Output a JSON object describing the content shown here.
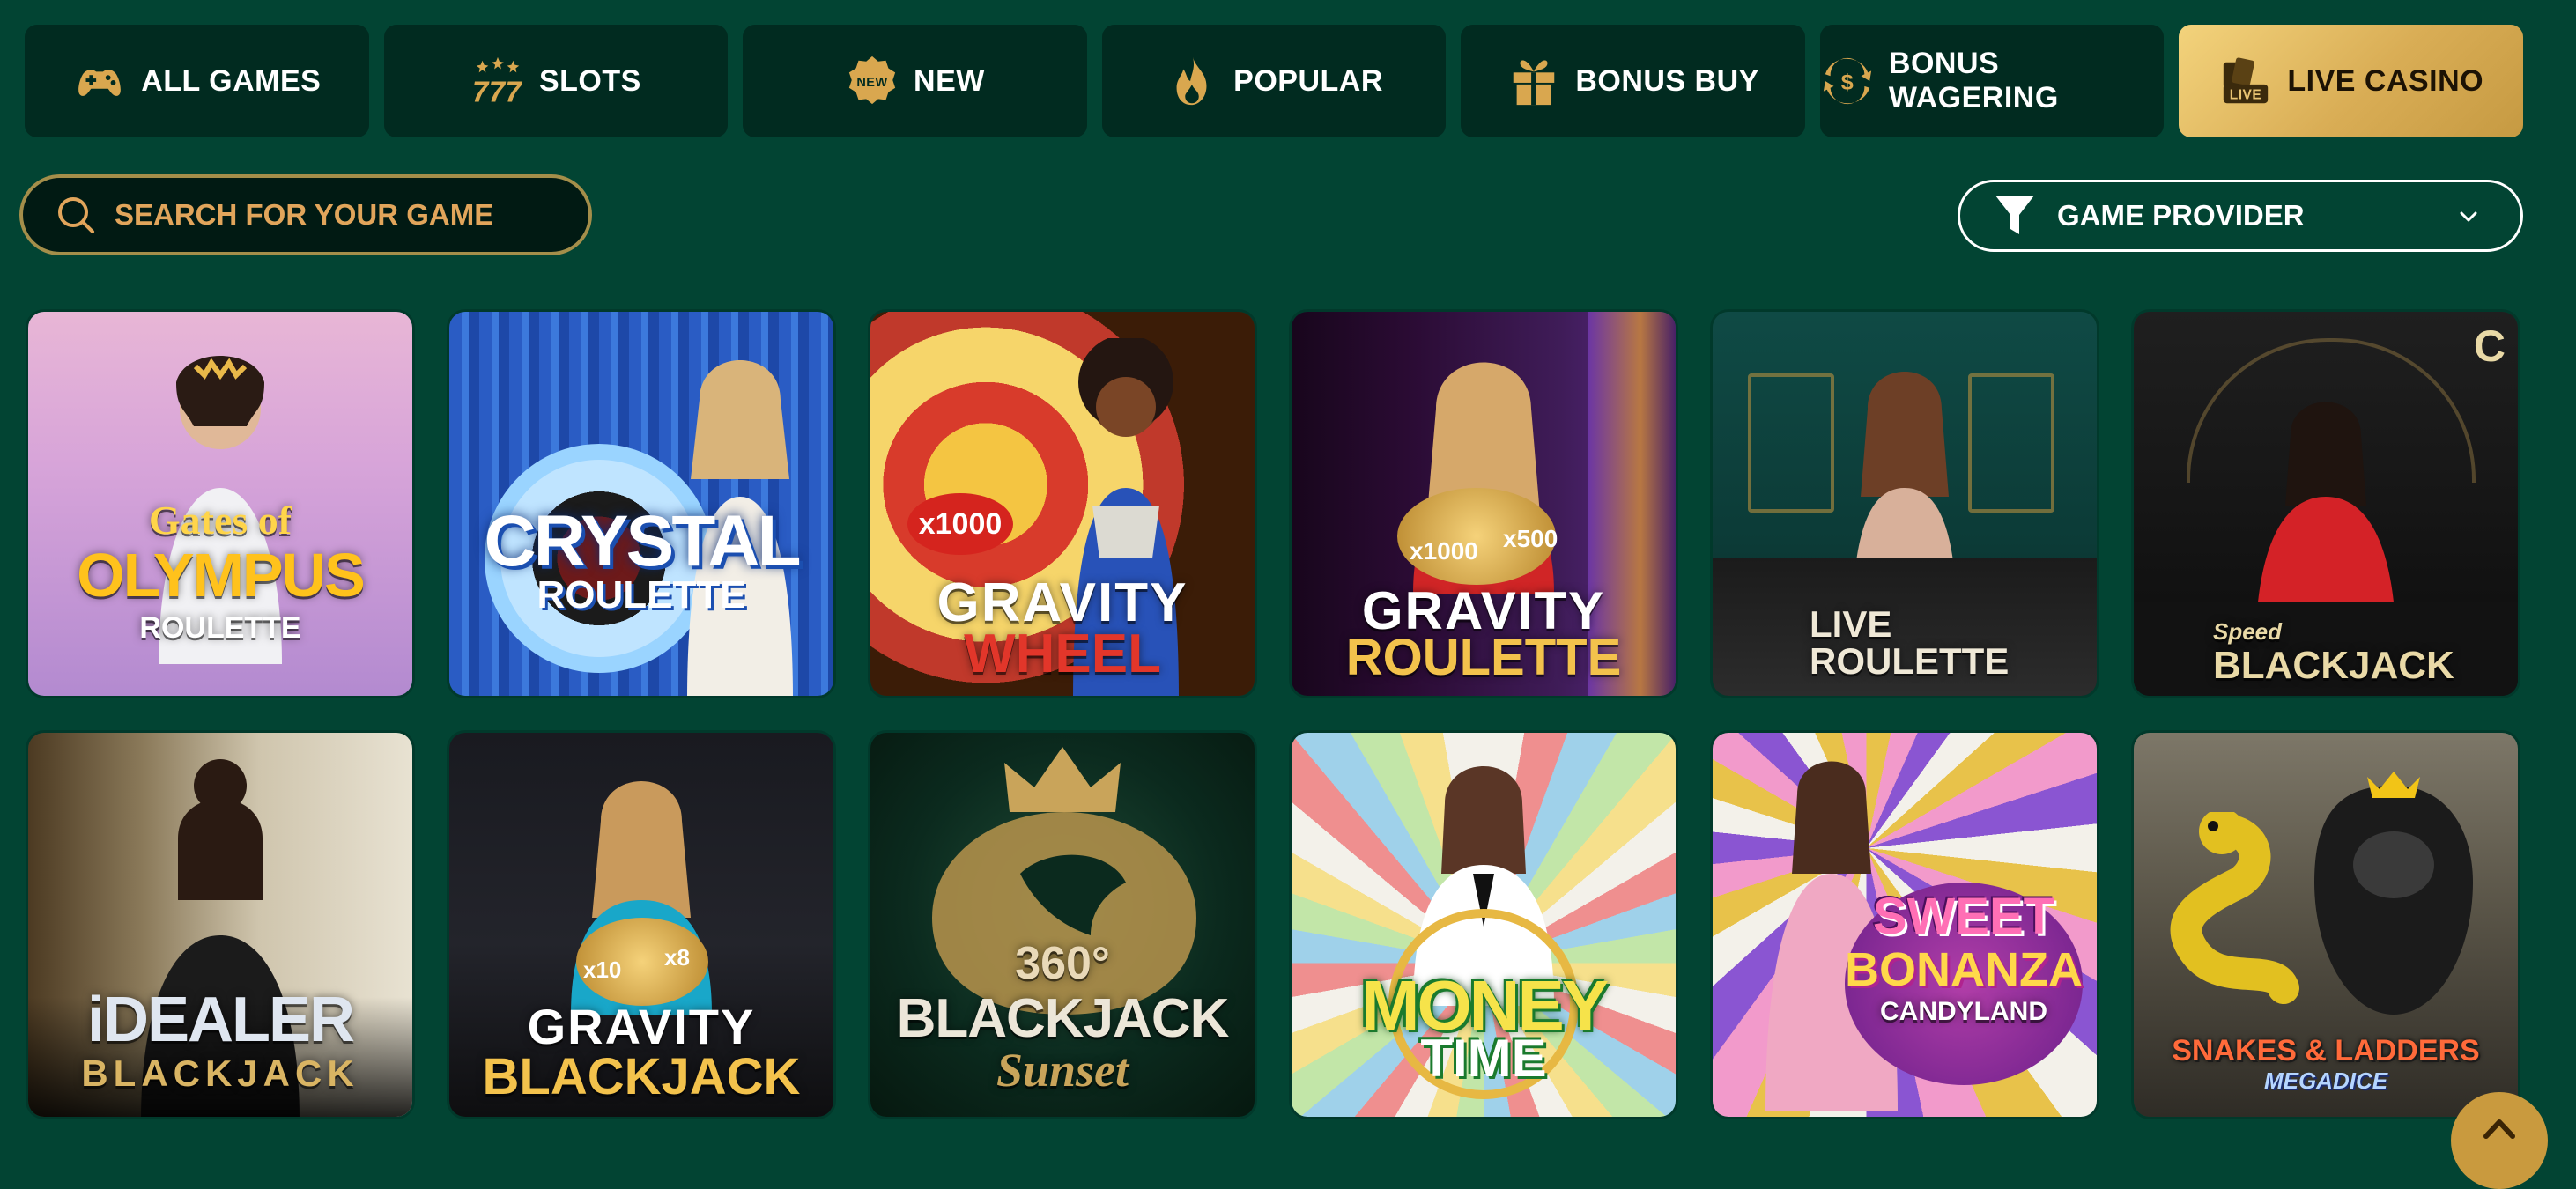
{
  "tabs": [
    {
      "label": "ALL GAMES",
      "icon": "gamepad-icon",
      "active": false
    },
    {
      "label": "SLOTS",
      "icon": "slots-777-icon",
      "active": false
    },
    {
      "label": "NEW",
      "icon": "new-badge-icon",
      "active": false
    },
    {
      "label": "POPULAR",
      "icon": "flame-icon",
      "active": false
    },
    {
      "label": "BONUS BUY",
      "icon": "gift-icon",
      "active": false
    },
    {
      "label": "BONUS WAGERING",
      "icon": "dollar-cycle-icon",
      "active": false
    },
    {
      "label": "LIVE CASINO",
      "icon": "live-cards-icon",
      "active": true
    }
  ],
  "search": {
    "placeholder": "SEARCH FOR YOUR GAME"
  },
  "provider": {
    "label": "GAME PROVIDER"
  },
  "games": [
    {
      "title_line1": "Gates of",
      "title_line2": "OLYMPUS",
      "title_line3": "ROULETTE"
    },
    {
      "title_line1": "CRYSTAL",
      "title_line2": "ROULETTE"
    },
    {
      "title_line1": "GRAVITY",
      "title_line2": "WHEEL",
      "badge": "x1000"
    },
    {
      "title_line1": "GRAVITY",
      "title_line2": "ROULETTE",
      "badge": "x1000",
      "badge2": "x500"
    },
    {
      "title_line1": "LIVE",
      "title_line2": "ROULETTE"
    },
    {
      "title_line1": "Speed",
      "title_line2": "BLACKJACK",
      "corner": "C"
    },
    {
      "title_line1": "iDEALER",
      "title_line2": "BLACKJACK"
    },
    {
      "title_line1": "GRAVITY",
      "title_line2": "BLACKJACK",
      "badge": "x10",
      "badge2": "x8"
    },
    {
      "title_line1": "360°",
      "title_line2": "BLACKJACK",
      "title_line3": "Sunset"
    },
    {
      "title_line1": "MONEY",
      "title_line2": "TIME"
    },
    {
      "title_line1": "SWEET",
      "title_line2": "BONANZA",
      "title_line3": "CANDYLAND"
    },
    {
      "title_line1": "SNAKES & LADDERS",
      "title_line2": "MEGADICE"
    }
  ],
  "colors": {
    "background": "#024433",
    "tab_bg": "#012b20",
    "active_gold": "#d9ad55",
    "search_text": "#e1a55b"
  }
}
